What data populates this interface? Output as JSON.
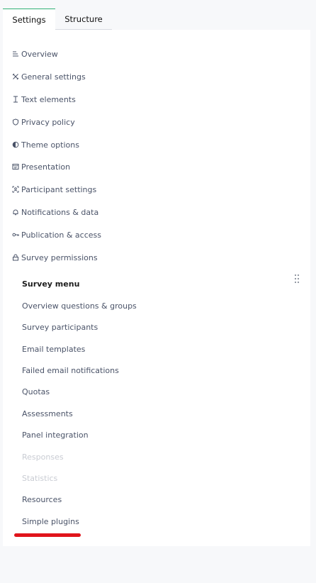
{
  "tabs": [
    {
      "label": "Settings",
      "active": true
    },
    {
      "label": "Structure",
      "active": false
    }
  ],
  "colors": {
    "active_tab_border": "#2fb074",
    "annotation_underline": "#e0141b",
    "disabled_text": "#c9ccd3"
  },
  "settings_nav": [
    {
      "label": "Overview",
      "icon": "list-icon"
    },
    {
      "label": "General settings",
      "icon": "tools-icon"
    },
    {
      "label": "Text elements",
      "icon": "text-cursor-icon"
    },
    {
      "label": "Privacy policy",
      "icon": "shield-icon"
    },
    {
      "label": "Theme options",
      "icon": "contrast-icon"
    },
    {
      "label": "Presentation",
      "icon": "presentation-icon"
    },
    {
      "label": "Participant settings",
      "icon": "participant-icon"
    },
    {
      "label": "Notifications & data",
      "icon": "bell-icon"
    },
    {
      "label": "Publication & access",
      "icon": "key-icon"
    },
    {
      "label": "Survey permissions",
      "icon": "lock-icon"
    }
  ],
  "survey_menu": {
    "title": "Survey menu",
    "items": [
      {
        "label": "Overview questions & groups",
        "disabled": false
      },
      {
        "label": "Survey participants",
        "disabled": false
      },
      {
        "label": "Email templates",
        "disabled": false
      },
      {
        "label": "Failed email notifications",
        "disabled": false
      },
      {
        "label": "Quotas",
        "disabled": false
      },
      {
        "label": "Assessments",
        "disabled": false
      },
      {
        "label": "Panel integration",
        "disabled": false
      },
      {
        "label": "Responses",
        "disabled": true
      },
      {
        "label": "Statistics",
        "disabled": true
      },
      {
        "label": "Resources",
        "disabled": false
      },
      {
        "label": "Simple plugins",
        "disabled": false
      }
    ]
  }
}
